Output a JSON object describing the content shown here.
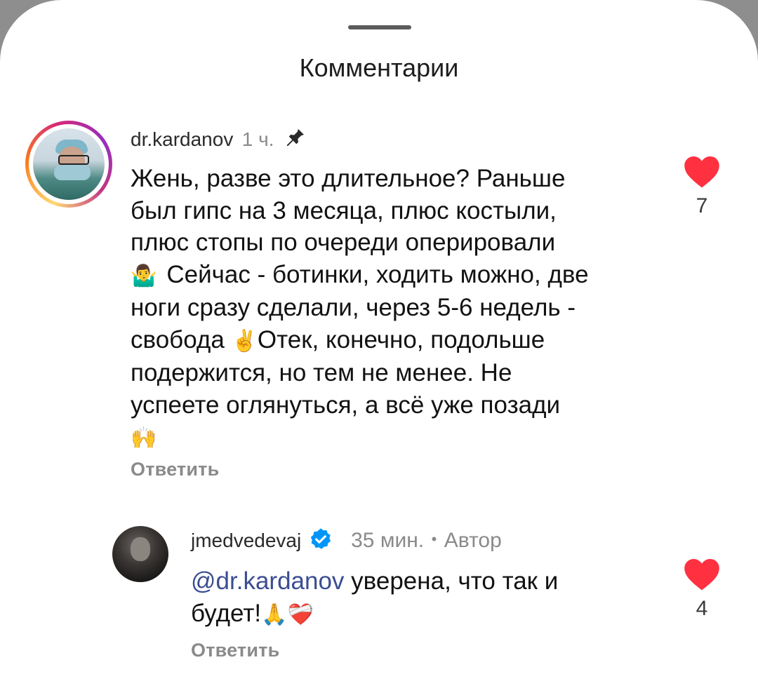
{
  "sheet": {
    "title": "Комментарии"
  },
  "comments": [
    {
      "username": "dr.kardanov",
      "time": "1 ч.",
      "pinned": true,
      "text_lines": [
        "Жень, разве это длительное? Раньше",
        "был гипс на 3 месяца, плюс костыли,",
        "плюс стопы по очереди оперировали",
        "Сейчас - ботинки, ходить можно, две",
        "ноги сразу сделали, через 5-6 недель -",
        "свобода",
        "Отек, конечно, подольше",
        "подержится, но тем не менее. Не",
        "успеете оглянуться, а всё уже позади"
      ],
      "emojis": [
        "🤷‍♂️",
        "✌️",
        "🙌"
      ],
      "reply_label": "Ответить",
      "likes": "7",
      "liked": true
    },
    {
      "username": "jmedvedevaj",
      "verified": true,
      "time": "35 мин.",
      "separator": "•",
      "author_label": "Автор",
      "mention": "@dr.kardanov",
      "text_after_mention": "уверена, что так и",
      "text_line2": "будет!",
      "emojis": [
        "🙏",
        "❤️‍🩹"
      ],
      "reply_label": "Ответить",
      "likes": "4",
      "liked": true
    }
  ],
  "icons": {
    "pin": "pin-icon",
    "heart": "heart-icon",
    "verified": "verified-badge-icon"
  },
  "colors": {
    "heart": "#ff3040",
    "verified": "#0095f6",
    "mention": "#3b4d91",
    "muted": "#8a8a8a"
  }
}
